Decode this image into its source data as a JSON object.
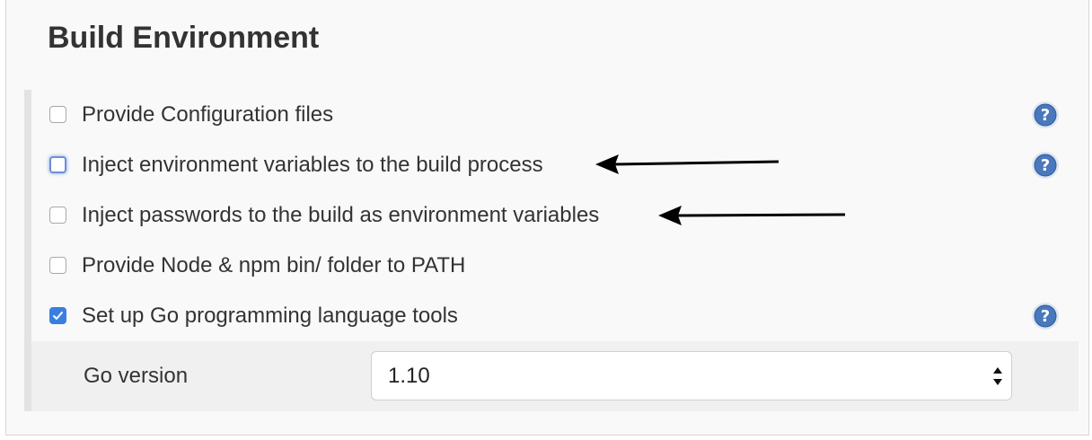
{
  "section": {
    "title": "Build Environment"
  },
  "options": [
    {
      "label": "Provide Configuration files",
      "checked": false,
      "has_help": true
    },
    {
      "label": "Inject environment variables to the build process",
      "checked": false,
      "focused": true,
      "has_help": true,
      "annotated_with_arrow": true
    },
    {
      "label": "Inject passwords to the build as environment variables",
      "checked": false,
      "has_help": false,
      "annotated_with_arrow": true
    },
    {
      "label": "Provide Node & npm bin/ folder to PATH",
      "checked": false,
      "has_help": false
    },
    {
      "label": "Set up Go programming language tools",
      "checked": true,
      "has_help": true
    }
  ],
  "go_settings": {
    "label": "Go version",
    "selected_value": "1.10"
  },
  "icons": {
    "help": "question-circle-icon",
    "arrow": "left-arrow-annotation-icon",
    "select": "up-down-chevron-icon",
    "check": "checkmark-icon"
  },
  "colors": {
    "checkbox_checked": "#3a7fe0",
    "help_icon": "#4a78bd",
    "panel_background": "#f9f9f9",
    "subsetting_background": "#f0f0f0"
  }
}
